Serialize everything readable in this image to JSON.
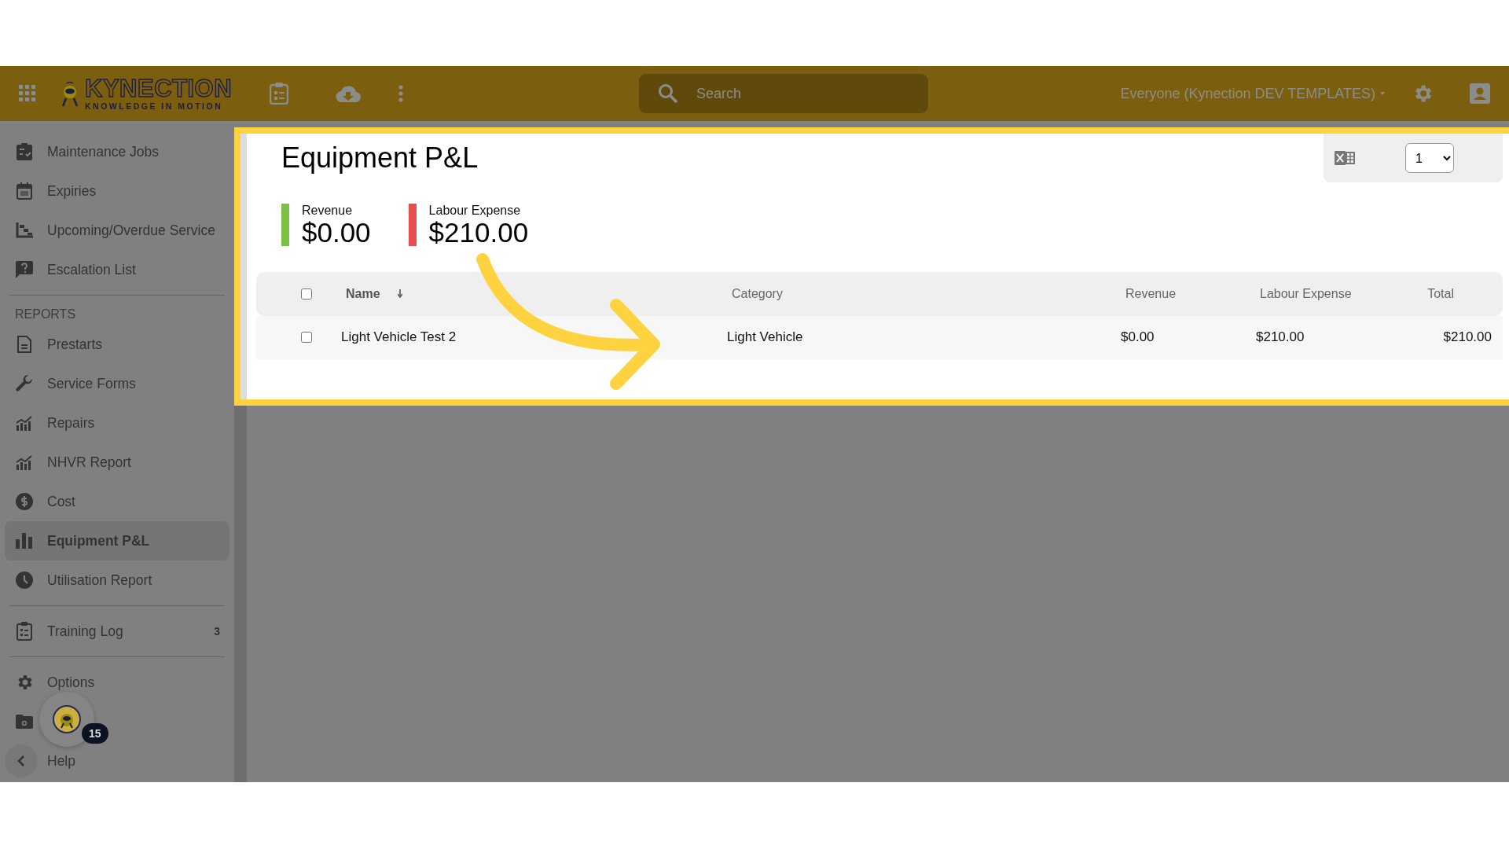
{
  "header": {
    "logo": {
      "title": "KYNECTION",
      "tagline": "KNOWLEDGE IN MOTION"
    },
    "search": {
      "placeholder": "Search"
    },
    "workspace": "Everyone (Kynection DEV TEMPLATES)"
  },
  "sidebar": {
    "groups": [
      {
        "items": [
          {
            "label": "Maintenance Jobs",
            "selected": false
          },
          {
            "label": "Expiries",
            "selected": false
          },
          {
            "label": "Upcoming/Overdue Service",
            "selected": false
          },
          {
            "label": "Escalation List",
            "selected": false
          }
        ]
      },
      {
        "heading": "REPORTS",
        "items": [
          {
            "label": "Prestarts",
            "selected": false
          },
          {
            "label": "Service Forms",
            "selected": false
          },
          {
            "label": "Repairs",
            "selected": false
          },
          {
            "label": "NHVR Report",
            "selected": false
          },
          {
            "label": "Cost",
            "selected": false
          },
          {
            "label": "Equipment P&L",
            "selected": true
          },
          {
            "label": "Utilisation Report",
            "selected": false
          }
        ]
      },
      {
        "items": [
          {
            "label": "Training Log",
            "count": "3",
            "selected": false
          }
        ]
      },
      {
        "items": [
          {
            "label": "Options",
            "selected": false
          },
          {
            "label": "Help",
            "selected": false
          }
        ]
      }
    ],
    "assistant_badge": "15"
  },
  "page": {
    "title": "Equipment P&L",
    "page_size": "1",
    "kpis": [
      {
        "label": "Revenue",
        "value": "$0.00",
        "color": "#7ac143"
      },
      {
        "label": "Labour Expense",
        "value": "$210.00",
        "color": "#e94e4e"
      }
    ],
    "table": {
      "select_all": {
        "checked": false
      },
      "columns": [
        "Name",
        "Category",
        "Revenue",
        "Labour Expense",
        "Total"
      ],
      "rows": [
        {
          "checked": false,
          "cells": [
            "Light Vehicle Test 2",
            "Light Vehicle",
            "$0.00",
            "$210.00",
            "$210.00"
          ]
        }
      ]
    }
  }
}
